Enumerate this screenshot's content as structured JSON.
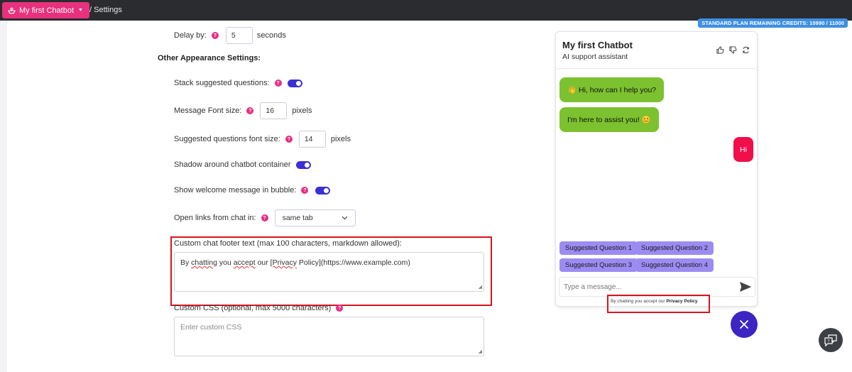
{
  "topbar": {
    "bot_label": "My first Chatbot",
    "breadcrumb": "/ Settings",
    "credits": "STANDARD PLAN REMAINING CREDITS: 10990 / 11000"
  },
  "settings": {
    "delay": {
      "label": "Delay by:",
      "value": "5",
      "unit": "seconds"
    },
    "section_title": "Other Appearance Settings:",
    "stack_suggested": {
      "label": "Stack suggested questions:"
    },
    "message_font": {
      "label": "Message Font size:",
      "value": "16",
      "unit": "pixels"
    },
    "suggested_font": {
      "label": "Suggested questions font size:",
      "value": "14",
      "unit": "pixels"
    },
    "shadow": {
      "label": "Shadow around chatbot container"
    },
    "welcome_bubble": {
      "label": "Show welcome message in bubble:"
    },
    "open_links": {
      "label": "Open links from chat in:",
      "value": "same tab"
    },
    "footer_text": {
      "label": "Custom chat footer text (max 100 characters, markdown allowed):",
      "value_pre": "By ",
      "value_w1": "chatting",
      "value_mid1": " you ",
      "value_w2": "accept",
      "value_mid2": " our ",
      "value_w3": "[Privacy",
      "value_post": " Policy](https://www.example.com)"
    },
    "custom_css": {
      "label": "Custom CSS (optional, max 5000 characters)",
      "placeholder": "Enter custom CSS"
    }
  },
  "chat": {
    "title": "My first Chatbot",
    "subtitle": "AI support assistant",
    "messages": [
      {
        "role": "bot",
        "text": "👋 Hi, how can I help you?"
      },
      {
        "role": "bot",
        "text": "I'm here to assist you! 😊"
      },
      {
        "role": "user",
        "text": "Hi"
      }
    ],
    "suggestions": [
      "Suggested Question 1",
      "Suggested Question 2",
      "Suggested Question 3",
      "Suggested Question 4"
    ],
    "input_placeholder": "Type a message...",
    "footer_pre": "By chatting you accept our ",
    "footer_link": "Privacy Policy"
  },
  "colors": {
    "brand_pink": "#e8317c",
    "toggle_on": "#3b2fd6",
    "bot_bubble": "#7cc12f",
    "user_bubble": "#f20d4b",
    "suggestion": "#9c8cf2",
    "highlight": "#d8151f"
  }
}
